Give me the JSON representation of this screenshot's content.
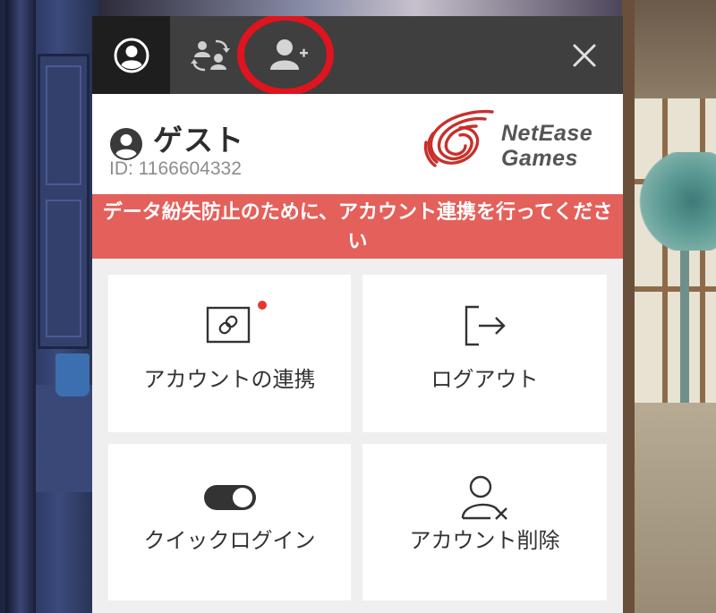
{
  "tabs": {
    "profile_icon": "user-circle-icon",
    "switch_icon": "switch-account-icon",
    "add_icon": "add-user-icon",
    "close_icon": "close-icon"
  },
  "account": {
    "name": "ゲスト",
    "id": "ID: 1166604332",
    "avatar_icon": "user-circle-icon"
  },
  "brand": {
    "line1": "NetEase",
    "line2": "Games",
    "color": "#c8302c"
  },
  "warning": {
    "text": "データ紛失防止のために、アカウント連携を行ってください",
    "background": "#e4605b"
  },
  "actions": [
    {
      "label": "アカウントの連携",
      "icon": "link-icon",
      "has_notification": true
    },
    {
      "label": "ログアウト",
      "icon": "logout-icon"
    },
    {
      "label": "クイックログイン",
      "icon": "toggle-icon"
    },
    {
      "label": "アカウント削除",
      "icon": "delete-user-icon"
    }
  ],
  "colors": {
    "tabbar": "#3f3f3f",
    "tab_active": "#1e1e1e",
    "highlight_ring": "#e0141e",
    "notification_dot": "#e8362e"
  }
}
